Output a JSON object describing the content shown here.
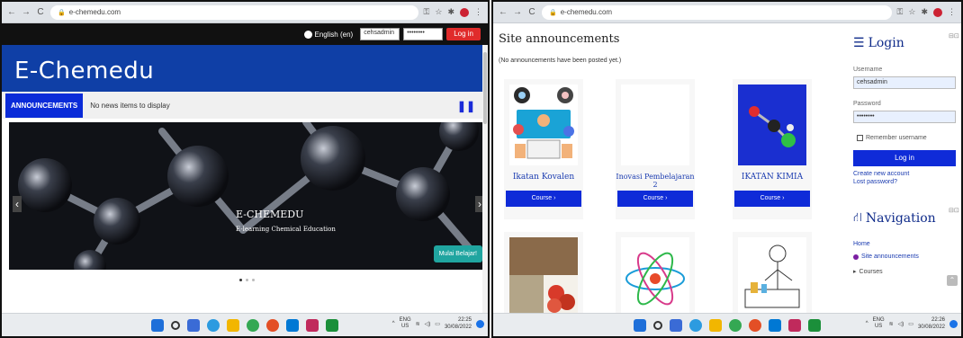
{
  "left": {
    "browser": {
      "url": "e-chemedu.com"
    },
    "topbar": {
      "language": "English (en)",
      "username": "cehsadmin",
      "password": "••••••••",
      "login": "Log in"
    },
    "brand": "E-Chemedu",
    "announcement": {
      "label": "ANNOUNCEMENTS",
      "text": "No news items to display"
    },
    "slide": {
      "title": "E-CHEMEDU",
      "subtitle": "E-learning Chemical Education",
      "button": "Mulai Belajar!"
    },
    "taskbar": {
      "lang": "ENG",
      "lang2": "US",
      "time": "22:25",
      "date": "30/08/2022"
    }
  },
  "right": {
    "browser": {
      "url": "e-chemedu.com"
    },
    "site_announcements": "Site announcements",
    "no_announcements": "(No announcements have been posted yet.)",
    "courses": [
      {
        "name": "Ikatan Kovalen",
        "button": "Course ›"
      },
      {
        "name": "Inovasi Pembelajaran 2",
        "button": "Course ›"
      },
      {
        "name": "IKATAN KIMIA",
        "button": "Course ›"
      }
    ],
    "login": {
      "title": "Login",
      "username_label": "Username",
      "username_value": "cehsadmin",
      "password_label": "Password",
      "password_value": "••••••••",
      "remember": "Remember username",
      "button": "Log in",
      "create": "Create new account",
      "lost": "Lost password?"
    },
    "navigation": {
      "title": "Navigation",
      "home": "Home",
      "site_announcements": "Site announcements",
      "courses": "Courses"
    },
    "taskbar": {
      "lang": "ENG",
      "lang2": "US",
      "time": "22:26",
      "date": "30/08/2022"
    }
  }
}
